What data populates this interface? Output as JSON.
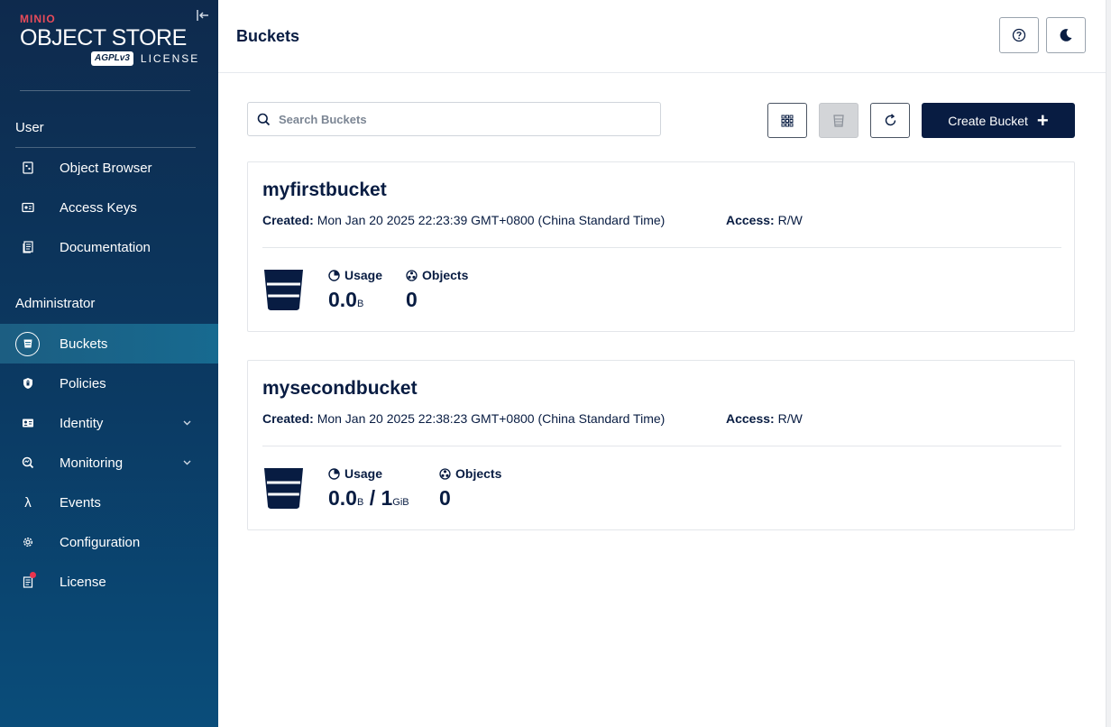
{
  "brand": {
    "minio": "MINIO",
    "product": "OBJECT STORE",
    "badge": "AGPLv3",
    "license_word": "LICENSE"
  },
  "sidebar": {
    "sections": {
      "user": "User",
      "admin": "Administrator"
    },
    "items": [
      {
        "label": "Object Browser",
        "icon": "object-browser-icon"
      },
      {
        "label": "Access Keys",
        "icon": "access-keys-icon"
      },
      {
        "label": "Documentation",
        "icon": "documentation-icon"
      },
      {
        "label": "Buckets",
        "icon": "bucket-icon",
        "active": true
      },
      {
        "label": "Policies",
        "icon": "policy-icon"
      },
      {
        "label": "Identity",
        "icon": "identity-icon",
        "expandable": true
      },
      {
        "label": "Monitoring",
        "icon": "monitoring-icon",
        "expandable": true
      },
      {
        "label": "Events",
        "icon": "lambda-icon"
      },
      {
        "label": "Configuration",
        "icon": "gear-icon"
      },
      {
        "label": "License",
        "icon": "license-icon",
        "badge": true
      }
    ]
  },
  "header": {
    "title": "Buckets"
  },
  "toolbar": {
    "search_placeholder": "Search Buckets",
    "create_label": "Create Bucket"
  },
  "buckets": [
    {
      "name": "myfirstbucket",
      "created_label": "Created:",
      "created": "Mon Jan 20 2025 22:23:39 GMT+0800 (China Standard Time)",
      "access_label": "Access:",
      "access": "R/W",
      "usage_label": "Usage",
      "usage_value": "0.0",
      "usage_unit": "B",
      "quota_value": "",
      "quota_unit": "",
      "objects_label": "Objects",
      "objects": "0"
    },
    {
      "name": "mysecondbucket",
      "created_label": "Created:",
      "created": "Mon Jan 20 2025 22:38:23 GMT+0800 (China Standard Time)",
      "access_label": "Access:",
      "access": "R/W",
      "usage_label": "Usage",
      "usage_value": "0.0",
      "usage_unit": "B",
      "quota_sep": " / ",
      "quota_value": "1",
      "quota_unit": "GiB",
      "objects_label": "Objects",
      "objects": "0"
    }
  ],
  "colors": {
    "navy": "#081c42",
    "sidebar_top": "#0e2a4d",
    "sidebar_bottom": "#0a4d7a",
    "active_item": "#176a90",
    "license_dot": "#e8344e",
    "minio_red": "#e84b5a"
  }
}
